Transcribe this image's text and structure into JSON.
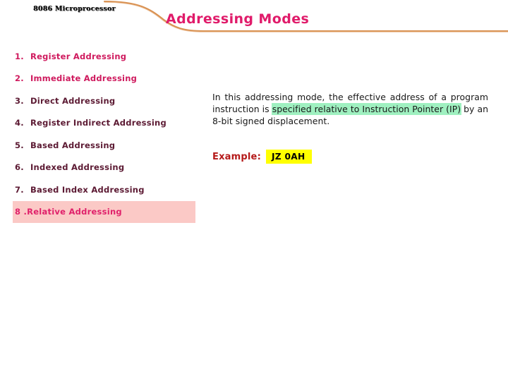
{
  "header": {
    "course_label": "8086 Microprocessor",
    "title": "Addressing Modes",
    "swoosh_color": "#d89050",
    "title_color": "#e01b6a"
  },
  "modes": {
    "items": [
      {
        "num": "1.",
        "label": "Register Addressing",
        "style": "accent"
      },
      {
        "num": "2.",
        "label": "Immediate Addressing",
        "style": "accent"
      },
      {
        "num": "3.",
        "label": "Direct Addressing",
        "style": "dark"
      },
      {
        "num": "4.",
        "label": "Register Indirect Addressing",
        "style": "dark"
      },
      {
        "num": "5.",
        "label": "Based Addressing",
        "style": "dark"
      },
      {
        "num": "6.",
        "label": "Indexed Addressing",
        "style": "dark"
      },
      {
        "num": "7.",
        "label": "Based Index Addressing",
        "style": "dark"
      },
      {
        "num": "8 .",
        "label": "Relative Addressing",
        "style": "hl"
      }
    ],
    "accent_color": "#cf1a5e",
    "dark_color": "#5c1a33",
    "highlight_bg": "#fbc9c6",
    "highlight_color": "#e0216b"
  },
  "description": {
    "part1": "In this addressing mode, the effective address of a program instruction is ",
    "highlight": "specified relative to Instruction Pointer (IP)",
    "part2": " by an 8-bit signed displacement.",
    "highlight_bg": "#9ff0c0"
  },
  "example": {
    "label": "Example:",
    "code": "JZ 0AH",
    "label_color": "#b51a1a",
    "code_bg": "#ffff00"
  }
}
